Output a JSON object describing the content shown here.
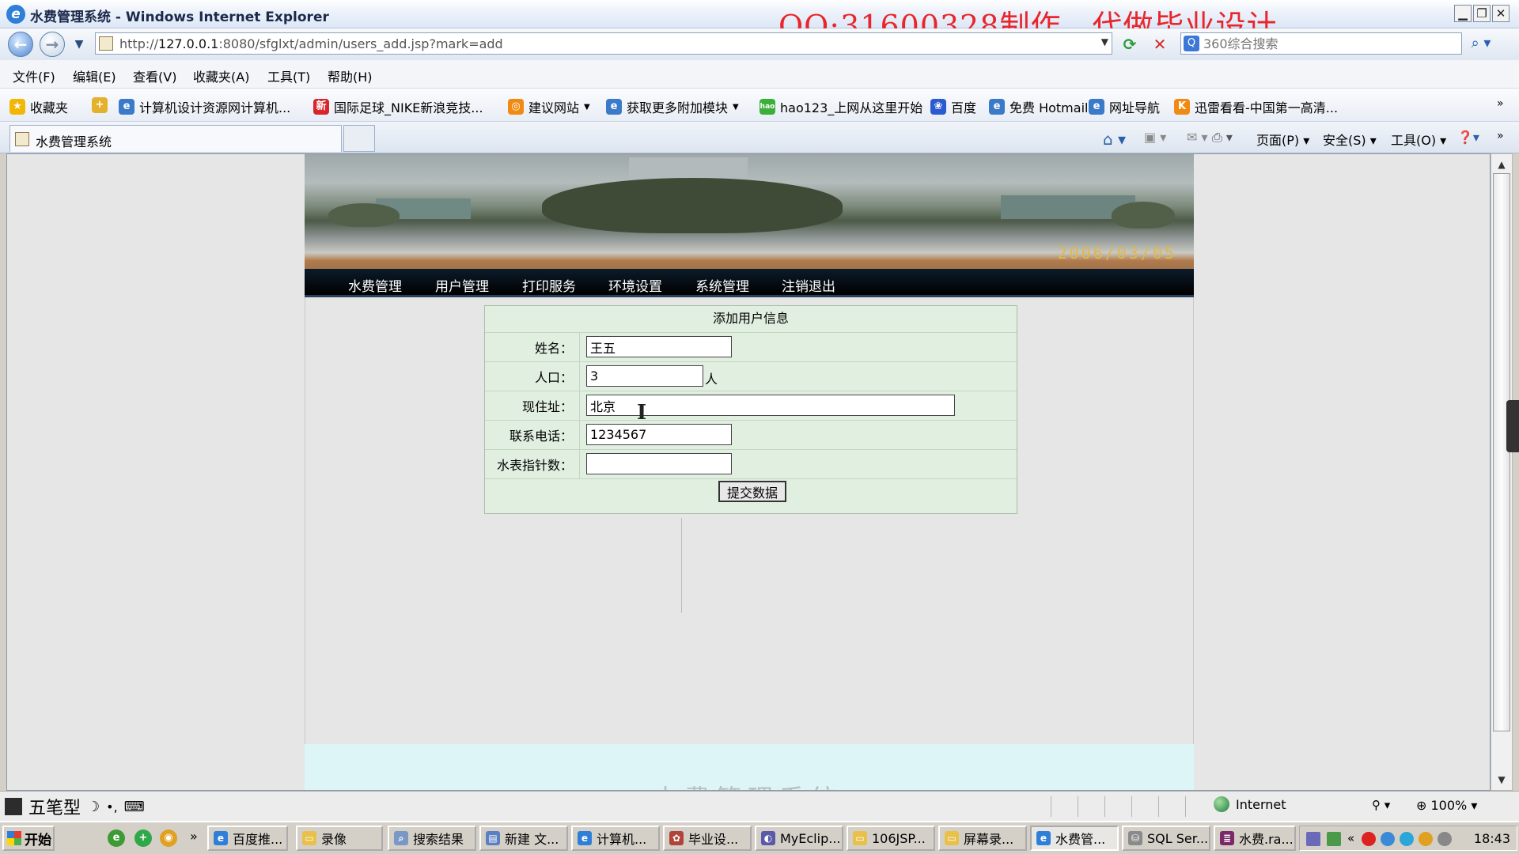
{
  "window": {
    "title": "水费管理系统 - Windows Internet Explorer",
    "watermark": "QQ:31600328制作，代做毕业设计"
  },
  "address_bar": {
    "url_prefix": "http://",
    "url_host": "127.0.0.1",
    "url_rest": ":8080/sfglxt/admin/users_add.jsp?mark=add"
  },
  "search": {
    "placeholder": "360综合搜索"
  },
  "menu": {
    "items": [
      "文件(F)",
      "编辑(E)",
      "查看(V)",
      "收藏夹(A)",
      "工具(T)",
      "帮助(H)"
    ]
  },
  "favorites": {
    "items": [
      "收藏夹",
      "计算机设计资源网计算机...",
      "国际足球_NIKE新浪竞技...",
      "建议网站",
      "获取更多附加模块",
      "hao123_上网从这里开始",
      "百度",
      "免费 Hotmail",
      "网址导航",
      "迅雷看看-中国第一高清..."
    ]
  },
  "tab": {
    "label": "水费管理系统"
  },
  "command_bar": {
    "items": [
      "页面(P)",
      "安全(S)",
      "工具(O)"
    ]
  },
  "banner": {
    "date": "2006/03/05"
  },
  "site_nav": {
    "items": [
      "水费管理",
      "用户管理",
      "打印服务",
      "环境设置",
      "系统管理",
      "注销退出"
    ]
  },
  "form": {
    "heading": "添加用户信息",
    "name_label": "姓名：",
    "name_value": "王五",
    "population_label": "人口：",
    "population_value": "3",
    "population_unit": "人",
    "address_label": "现住址：",
    "address_value": "北京",
    "phone_label": "联系电话：",
    "phone_value": "1234567",
    "meter_label": "水表指针数：",
    "meter_value": "",
    "submit_label": "提交数据"
  },
  "footer": {
    "text": "水费管理系统"
  },
  "status_bar": {
    "ime": "五笔型",
    "zone": "Internet",
    "zoom": "100%"
  },
  "taskbar": {
    "start": "开始",
    "tasks": [
      "百度推...",
      "录像",
      "搜索结果",
      "新建 文...",
      "计算机...",
      "毕业设...",
      "MyEclip...",
      "106JSP...",
      "屏幕录...",
      "水费管...",
      "SQL Ser...",
      "水费.ra..."
    ],
    "clock": "18:43"
  }
}
